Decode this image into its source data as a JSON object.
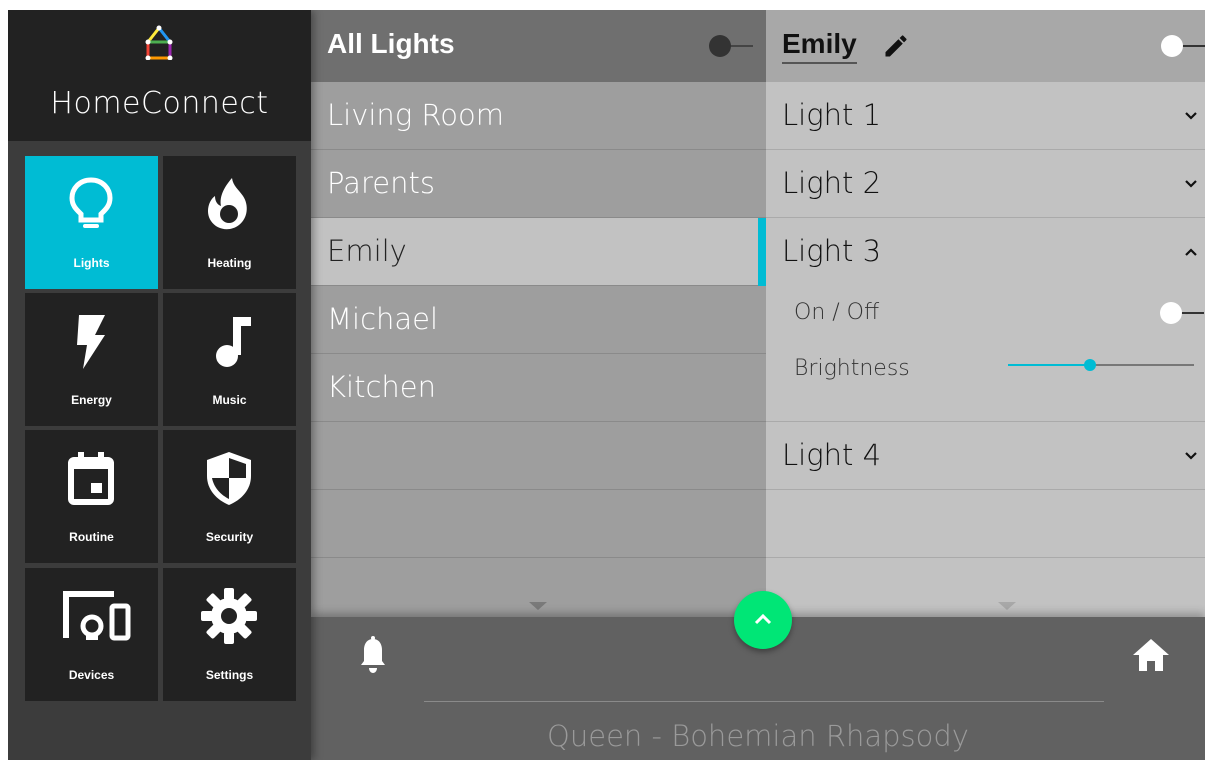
{
  "app": {
    "name": "HomeConnect",
    "accent_color": "#00bcd4",
    "fab_color": "#00e676"
  },
  "nav": [
    {
      "label": "Lights",
      "icon": "lightbulb-icon",
      "active": true
    },
    {
      "label": "Heating",
      "icon": "flame-icon",
      "active": false
    },
    {
      "label": "Energy",
      "icon": "lightning-bolt-icon",
      "active": false
    },
    {
      "label": "Music",
      "icon": "music-note-icon",
      "active": false
    },
    {
      "label": "Routine",
      "icon": "calendar-icon",
      "active": false
    },
    {
      "label": "Security",
      "icon": "shield-icon",
      "active": false
    },
    {
      "label": "Devices",
      "icon": "devices-icon",
      "active": false
    },
    {
      "label": "Settings",
      "icon": "gear-icon",
      "active": false
    }
  ],
  "rooms": {
    "header": {
      "title": "All Lights",
      "toggle_on": false
    },
    "items": [
      {
        "label": "Living Room",
        "selected": false
      },
      {
        "label": "Parents",
        "selected": false
      },
      {
        "label": "Emily",
        "selected": true
      },
      {
        "label": "Michael",
        "selected": false
      },
      {
        "label": "Kitchen",
        "selected": false
      }
    ]
  },
  "room_detail": {
    "title": "Emily",
    "toggle_on": true,
    "lights": [
      {
        "label": "Light 1",
        "expanded": false
      },
      {
        "label": "Light 2",
        "expanded": false
      },
      {
        "label": "Light 3",
        "expanded": true
      },
      {
        "label": "Light 4",
        "expanded": false
      }
    ],
    "expanded_controls": {
      "on_off_label": "On / Off",
      "on_off_value": true,
      "brightness_label": "Brightness",
      "brightness_value": 0.44
    }
  },
  "bottom_bar": {
    "now_playing": "Queen - Bohemian Rhapsody"
  }
}
